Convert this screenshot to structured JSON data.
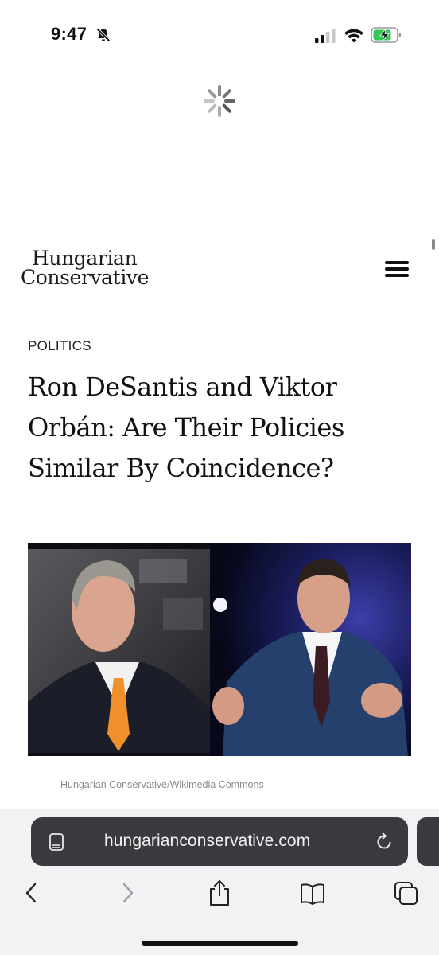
{
  "status_bar": {
    "time": "9:47",
    "icons": [
      "bell-slash-icon",
      "cellular-signal-icon",
      "wifi-icon",
      "battery-charging-icon"
    ],
    "battery_color": "#34c759"
  },
  "page": {
    "loading_icon": "spinner-icon"
  },
  "site": {
    "logo_line1": "Hungarian",
    "logo_line2": "Conservative",
    "menu_icon": "hamburger-menu-icon"
  },
  "article": {
    "category": "POLITICS",
    "headline": "Ron DeSantis and Viktor Orbán: Are Their Policies Similar By Coincidence?",
    "image_caption": "Hungarian Conservative/Wikimedia Commons"
  },
  "browser": {
    "url": "hungarianconservative.com",
    "url_bar_icons": [
      "reader-view-icon",
      "reload-icon"
    ],
    "toolbar_icons": [
      "back-icon",
      "forward-icon",
      "share-icon",
      "bookmarks-icon",
      "tabs-icon"
    ]
  }
}
